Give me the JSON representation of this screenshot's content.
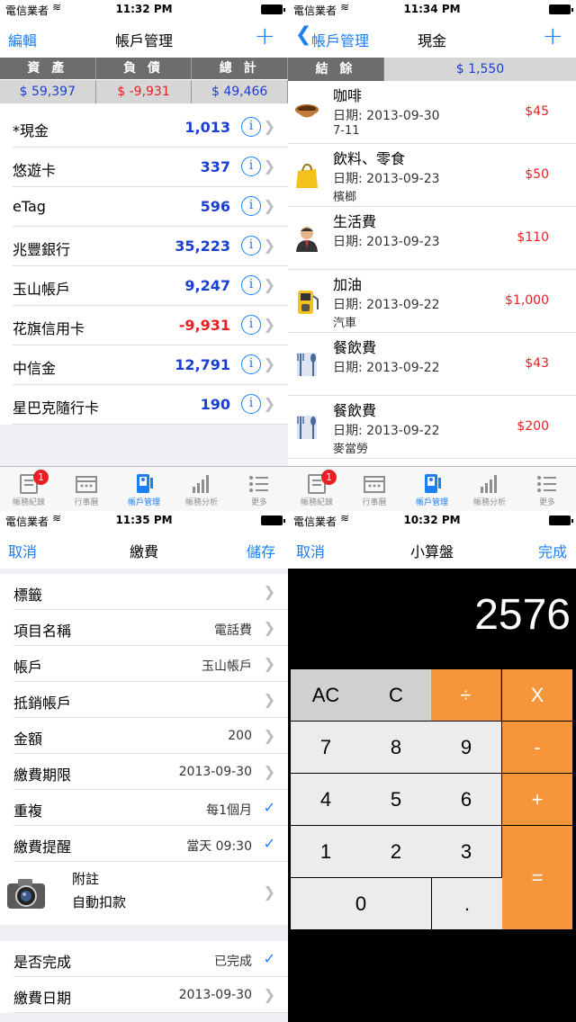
{
  "p1": {
    "status": {
      "carrier": "電信業者",
      "time": "11:32 PM"
    },
    "nav": {
      "left": "編輯",
      "title": "帳戶管理"
    },
    "summary": {
      "headers": [
        "資 產",
        "負 債",
        "總 計"
      ],
      "values": [
        "$ 59,397",
        "$ -9,931",
        "$ 49,466"
      ],
      "colors": [
        "#1a3fd0",
        "#e62020",
        "#1a3fd0"
      ]
    },
    "accounts": [
      {
        "name": "*現金",
        "amount": "1,013",
        "color": "#1a3fd0"
      },
      {
        "name": "悠遊卡",
        "amount": "337",
        "color": "#1a3fd0"
      },
      {
        "name": "eTag",
        "amount": "596",
        "color": "#1a3fd0"
      },
      {
        "name": "兆豐銀行",
        "amount": "35,223",
        "color": "#1a3fd0"
      },
      {
        "name": "玉山帳戶",
        "amount": "9,247",
        "color": "#1a3fd0"
      },
      {
        "name": "花旗信用卡",
        "amount": "-9,931",
        "color": "#e62020"
      },
      {
        "name": "中信金",
        "amount": "12,791",
        "color": "#1a3fd0"
      },
      {
        "name": "星巴克隨行卡",
        "amount": "190",
        "color": "#1a3fd0"
      }
    ],
    "tabs": [
      {
        "label": "帳務紀錄",
        "badge": "1"
      },
      {
        "label": "行事曆"
      },
      {
        "label": "帳戶管理"
      },
      {
        "label": "帳務分析"
      },
      {
        "label": "更多"
      }
    ]
  },
  "p2": {
    "status": {
      "carrier": "電信業者",
      "time": "11:34 PM"
    },
    "nav": {
      "back": "帳戶管理",
      "title": "現金"
    },
    "balance": {
      "label": "結 餘",
      "value": "$ 1,550"
    },
    "transactions": [
      {
        "title": "咖啡",
        "date": "日期: 2013-09-30",
        "note": "7-11",
        "amount": "$45",
        "icon": "coffee-cup-icon"
      },
      {
        "title": "飲料、零食",
        "date": "日期: 2013-09-23",
        "note": "檳榔",
        "amount": "$50",
        "icon": "shopping-bag-icon"
      },
      {
        "title": "生活費",
        "date": "日期: 2013-09-23",
        "note": "",
        "amount": "$110",
        "icon": "person-icon"
      },
      {
        "title": "加油",
        "date": "日期: 2013-09-22",
        "note": "汽車",
        "amount": "$1,000",
        "icon": "gas-pump-icon"
      },
      {
        "title": "餐飲費",
        "date": "日期: 2013-09-22",
        "note": "",
        "amount": "$43",
        "icon": "cutlery-icon"
      },
      {
        "title": "餐飲費",
        "date": "日期: 2013-09-22",
        "note": "麥當勞",
        "amount": "$200",
        "icon": "cutlery-icon"
      }
    ],
    "tabs": [
      {
        "label": "帳務紀錄",
        "badge": "1"
      },
      {
        "label": "行事曆"
      },
      {
        "label": "帳戶管理"
      },
      {
        "label": "帳務分析"
      },
      {
        "label": "更多"
      }
    ]
  },
  "p3": {
    "status": {
      "carrier": "電信業者",
      "time": "11:35 PM"
    },
    "nav": {
      "left": "取消",
      "title": "繳費",
      "right": "儲存"
    },
    "rows": [
      {
        "label": "標籤",
        "value": ""
      },
      {
        "label": "項目名稱",
        "value": "電話費"
      },
      {
        "label": "帳戶",
        "value": "玉山帳戶"
      },
      {
        "label": "抵銷帳戶",
        "value": ""
      },
      {
        "label": "金額",
        "value": "200"
      },
      {
        "label": "繳費期限",
        "value": "2013-09-30"
      },
      {
        "label": "重複",
        "value": "每1個月"
      },
      {
        "label": "繳費提醒",
        "value": "當天 09:30"
      }
    ],
    "note": {
      "label": "附註",
      "value": "自動扣款"
    },
    "done": {
      "label": "是否完成",
      "value": "已完成"
    },
    "paydate": {
      "label": "繳費日期",
      "value": "2013-09-30"
    }
  },
  "p4": {
    "status": {
      "carrier": "電信業者",
      "time": "10:32 PM"
    },
    "nav": {
      "left": "取消",
      "title": "小算盤",
      "right": "完成"
    },
    "display": "2576",
    "keys": {
      "ac": "AC",
      "c": "C",
      "div": "÷",
      "mul": "X",
      "k7": "7",
      "k8": "8",
      "k9": "9",
      "sub": "-",
      "k4": "4",
      "k5": "5",
      "k6": "6",
      "add": "+",
      "k1": "1",
      "k2": "2",
      "k3": "3",
      "eq": "=",
      "k0": "0",
      "dot": "."
    }
  }
}
